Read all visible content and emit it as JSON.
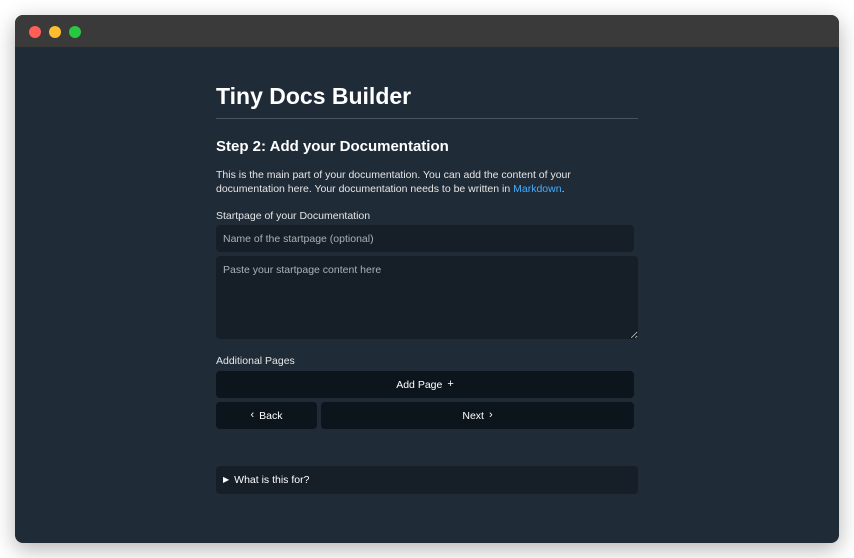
{
  "window": {
    "controls": [
      "close",
      "minimize",
      "maximize"
    ]
  },
  "app": {
    "title": "Tiny Docs Builder"
  },
  "step": {
    "heading": "Step 2: Add your Documentation",
    "intro_text": "This is the main part of your documentation. You can add the content of your documentation here. Your documentation needs to be written in ",
    "markdown_link": "Markdown",
    "intro_end": "."
  },
  "startpage": {
    "label": "Startpage of your Documentation",
    "name_placeholder": "Name of the startpage (optional)",
    "content_placeholder": "Paste your startpage content here"
  },
  "additional": {
    "label": "Additional Pages",
    "add_button": "Add Page",
    "add_icon": "+"
  },
  "nav": {
    "back_label": "Back",
    "back_icon": "‹",
    "next_label": "Next",
    "next_icon": "›"
  },
  "details": {
    "icon": "▶",
    "summary": "What is this for?"
  },
  "colors": {
    "background": "#202b38",
    "link": "#41adff",
    "field": "#161f27",
    "button": "#0c151c"
  }
}
